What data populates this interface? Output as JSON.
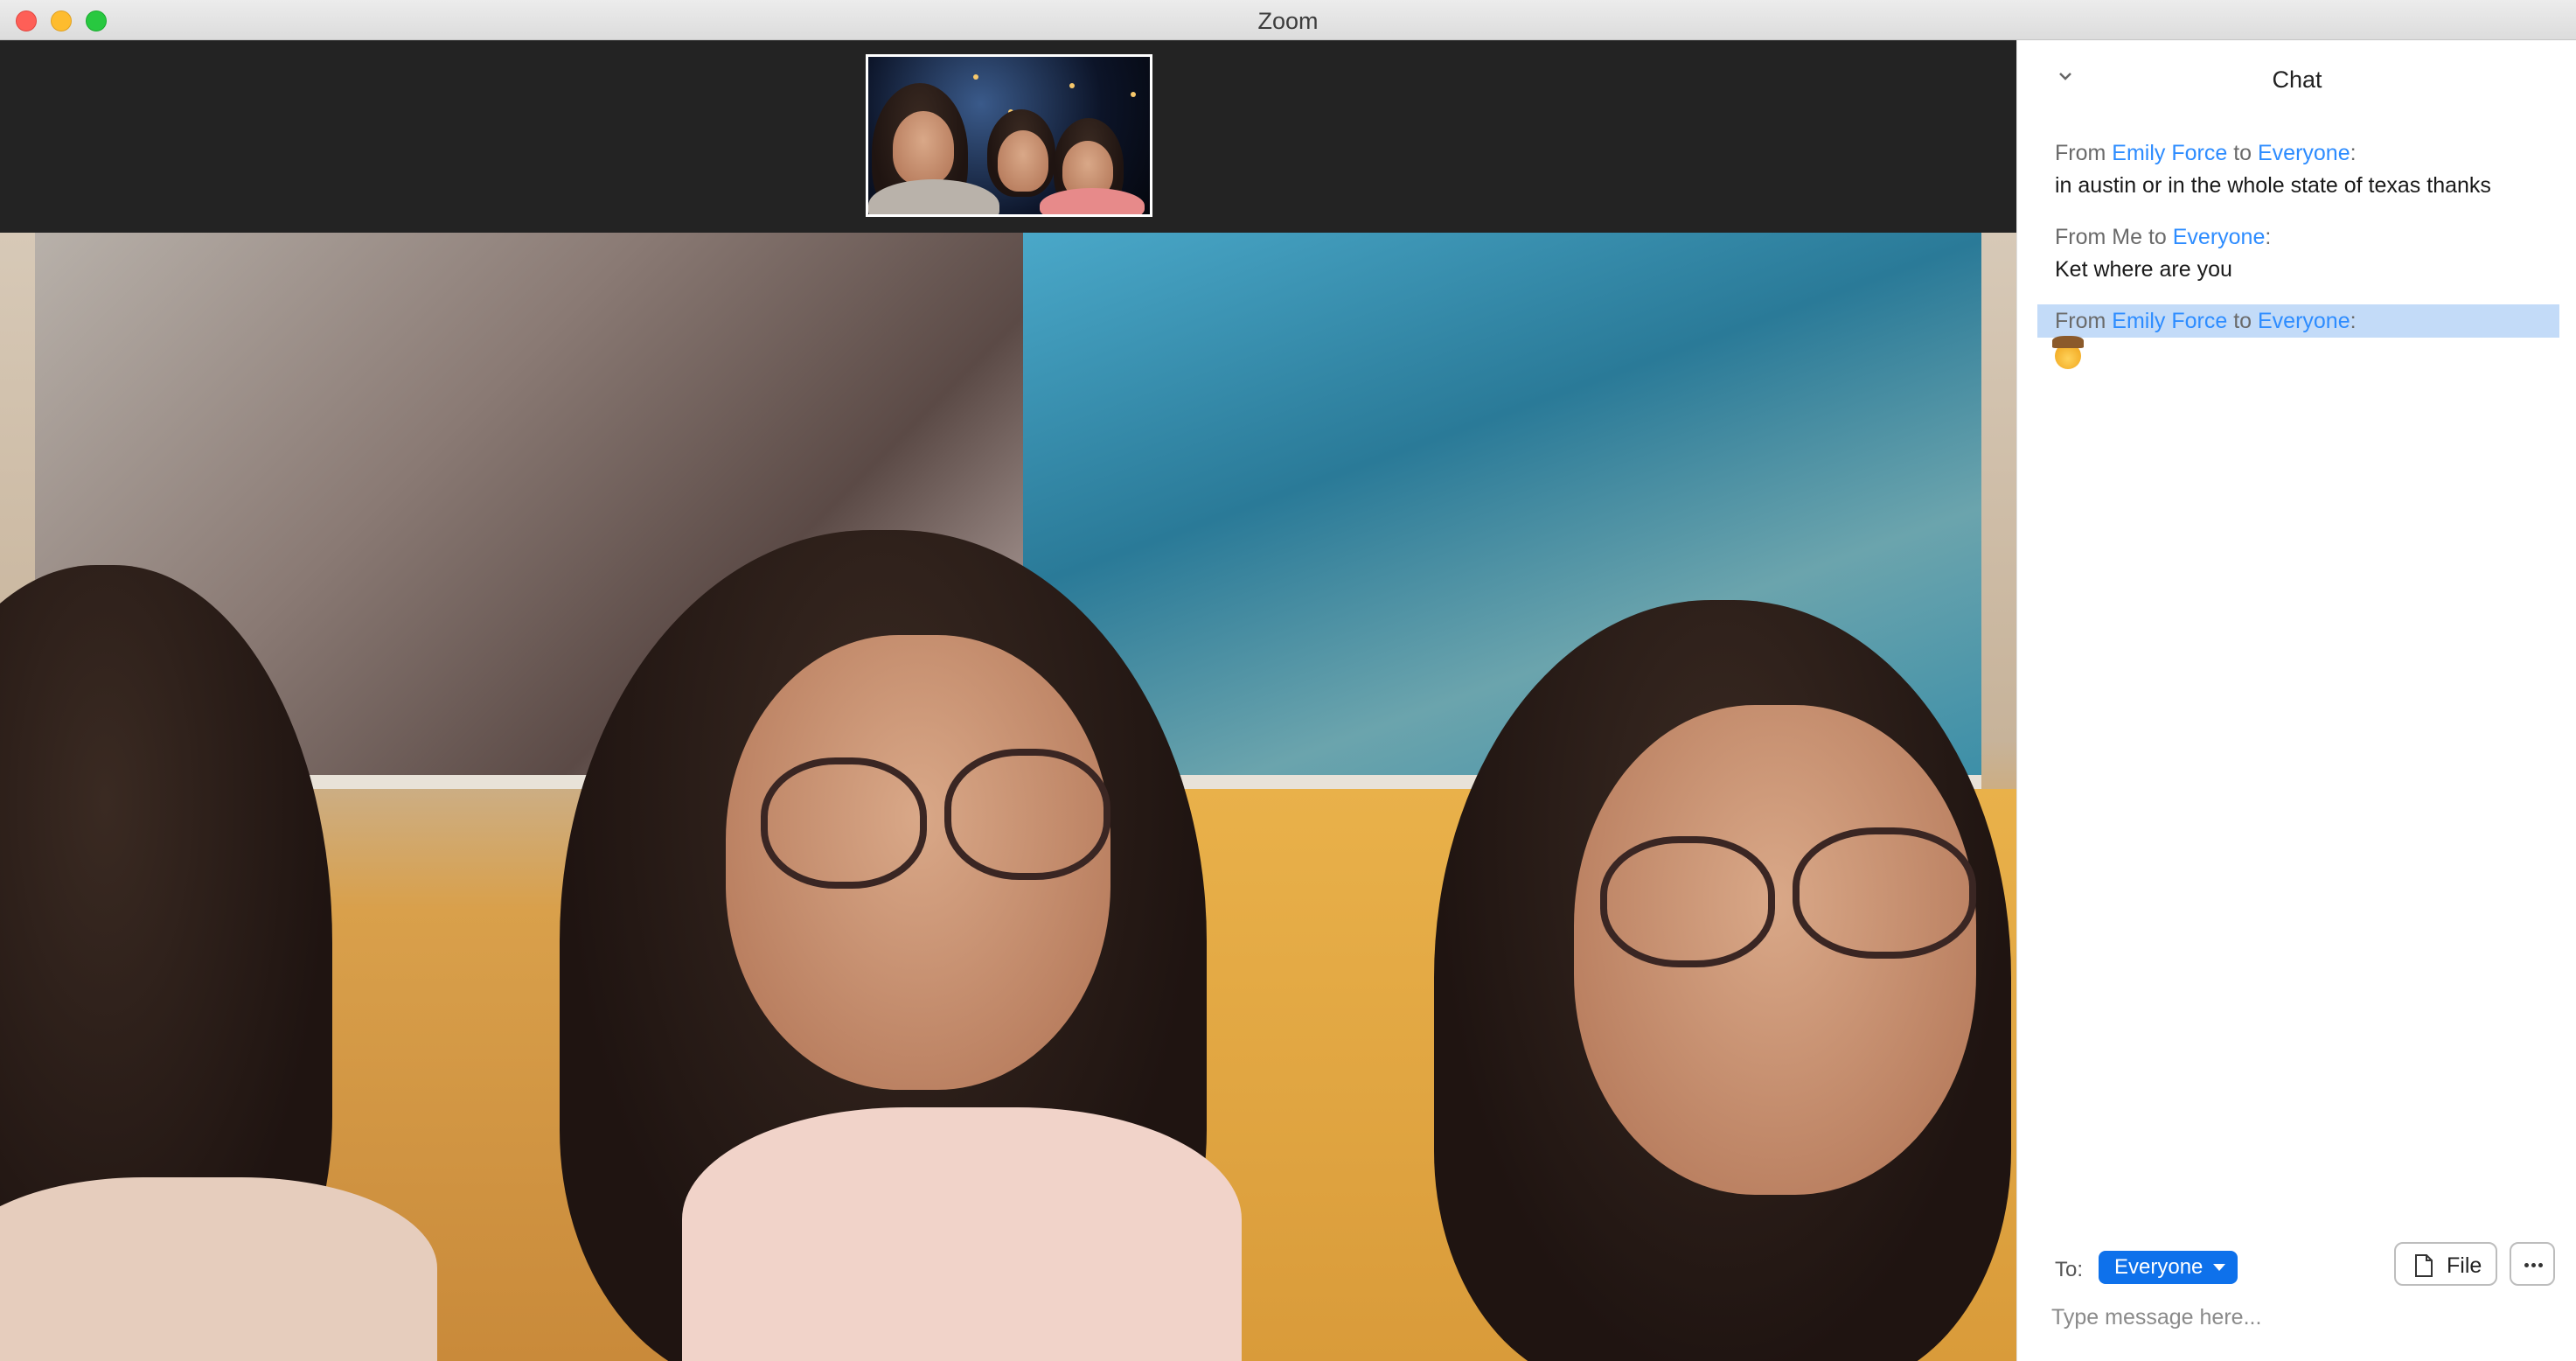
{
  "window": {
    "title": "Zoom"
  },
  "chat": {
    "title": "Chat",
    "messages": [
      {
        "prefix": "From ",
        "sender": "Emily Force",
        "mid": " to ",
        "recipient": "Everyone",
        "suffix": ":",
        "body": "in austin or in the whole state of texas thanks",
        "selected": false
      },
      {
        "prefix": "From Me to ",
        "recipient": "Everyone",
        "suffix": ":",
        "body": "Ket where are you",
        "selected": false
      },
      {
        "prefix": "From ",
        "sender": "Emily Force",
        "mid": " to ",
        "recipient": "Everyone",
        "suffix": ":",
        "body_icon": "cowboy-face-emoji",
        "selected": true
      }
    ],
    "to_label": "To:",
    "to_value": "Everyone",
    "file_label": "File",
    "input_placeholder": "Type message here..."
  },
  "colors": {
    "link": "#2d8cff",
    "selected_bg": "#c3dbf8",
    "to_select_bg": "#0e71eb",
    "video_strip_bg": "#232323"
  }
}
